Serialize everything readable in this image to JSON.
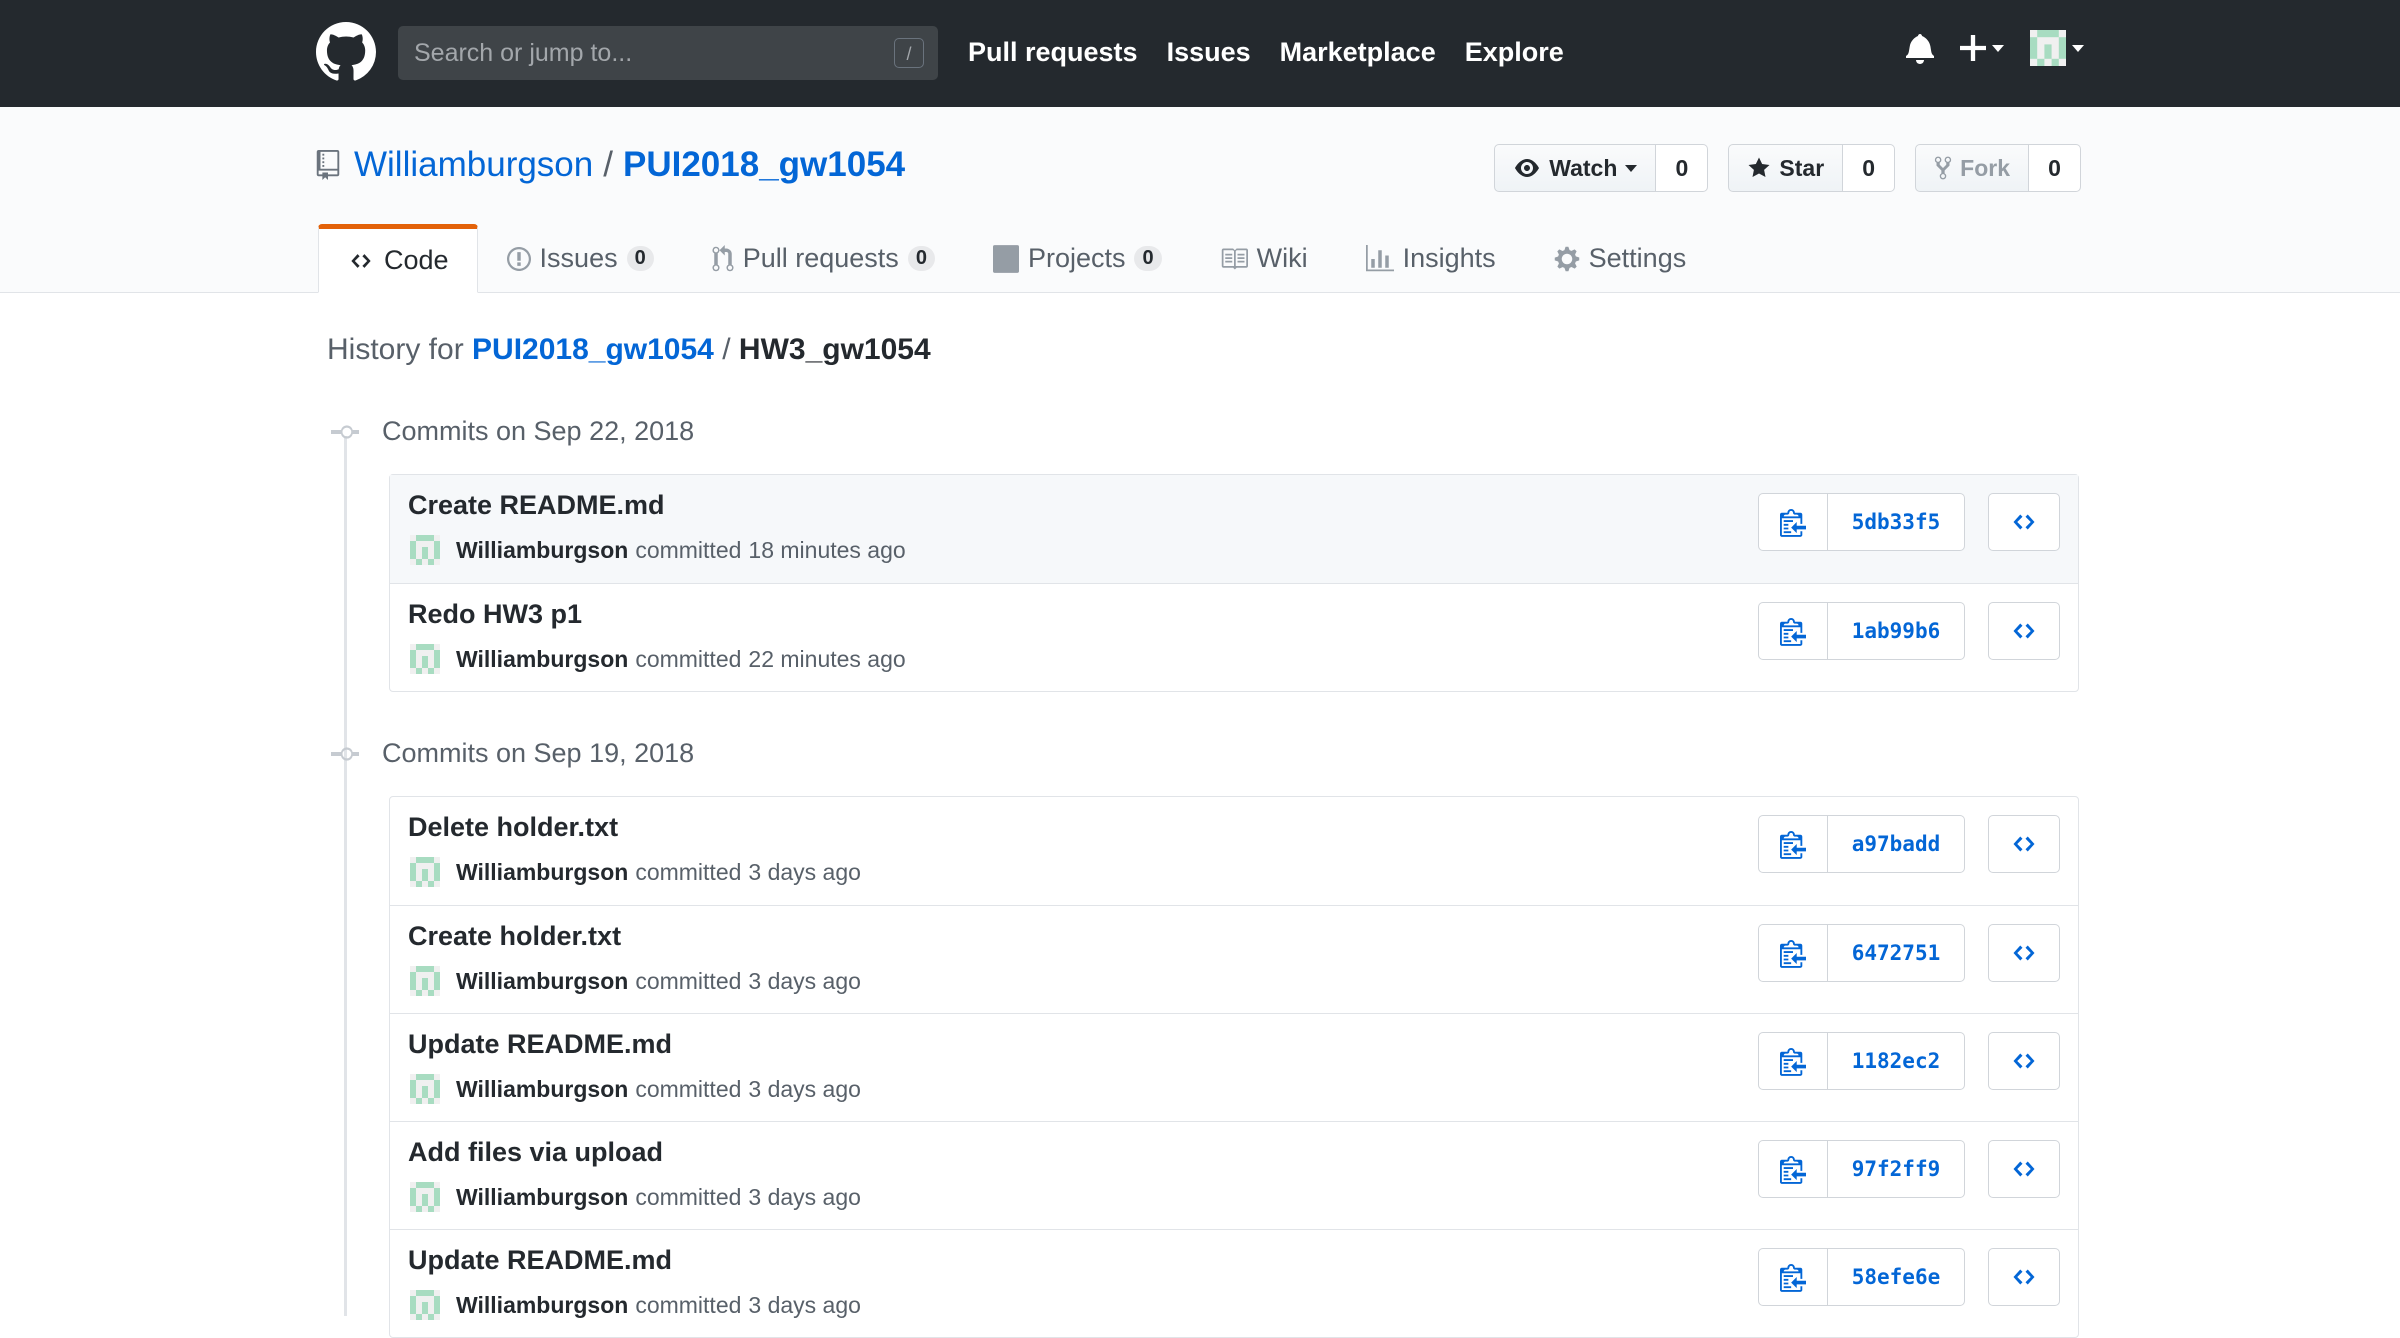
{
  "header": {
    "search_placeholder": "Search or jump to...",
    "search_shortcut": "/",
    "nav": [
      "Pull requests",
      "Issues",
      "Marketplace",
      "Explore"
    ],
    "plus_label": "+"
  },
  "repo": {
    "owner": "Williamburgson",
    "separator": "/",
    "name": "PUI2018_gw1054",
    "watch_label": "Watch",
    "watch_count": "0",
    "star_label": "Star",
    "star_count": "0",
    "fork_label": "Fork",
    "fork_count": "0"
  },
  "tabs": [
    {
      "label": "Code",
      "icon": "code-icon",
      "selected": true
    },
    {
      "label": "Issues",
      "count": "0",
      "icon": "issue-icon"
    },
    {
      "label": "Pull requests",
      "count": "0",
      "icon": "pull-request-icon"
    },
    {
      "label": "Projects",
      "count": "0",
      "icon": "project-icon"
    },
    {
      "label": "Wiki",
      "icon": "book-icon"
    },
    {
      "label": "Insights",
      "icon": "graph-icon"
    },
    {
      "label": "Settings",
      "icon": "gear-icon"
    }
  ],
  "history": {
    "prefix": "History for",
    "repo": "PUI2018_gw1054",
    "separator": "/",
    "path": "HW3_gw1054"
  },
  "commit_groups": [
    {
      "date_label": "Commits on Sep 22, 2018",
      "commits": [
        {
          "message": "Create README.md",
          "author": "Williamburgson",
          "verb": "committed",
          "time": "18 minutes ago",
          "sha": "5db33f5"
        },
        {
          "message": "Redo HW3 p1",
          "author": "Williamburgson",
          "verb": "committed",
          "time": "22 minutes ago",
          "sha": "1ab99b6"
        }
      ]
    },
    {
      "date_label": "Commits on Sep 19, 2018",
      "commits": [
        {
          "message": "Delete holder.txt",
          "author": "Williamburgson",
          "verb": "committed",
          "time": "3 days ago",
          "sha": "a97badd"
        },
        {
          "message": "Create holder.txt",
          "author": "Williamburgson",
          "verb": "committed",
          "time": "3 days ago",
          "sha": "6472751"
        },
        {
          "message": "Update README.md",
          "author": "Williamburgson",
          "verb": "committed",
          "time": "3 days ago",
          "sha": "1182ec2"
        },
        {
          "message": "Add files via upload",
          "author": "Williamburgson",
          "verb": "committed",
          "time": "3 days ago",
          "sha": "97f2ff9"
        },
        {
          "message": "Update README.md",
          "author": "Williamburgson",
          "verb": "committed",
          "time": "3 days ago",
          "sha": "58efe6e"
        }
      ]
    }
  ],
  "colors": {
    "header_bg": "#24292e",
    "link": "#0366d6",
    "tab_accent": "#e36209",
    "avatar": "#a8dcc1"
  }
}
